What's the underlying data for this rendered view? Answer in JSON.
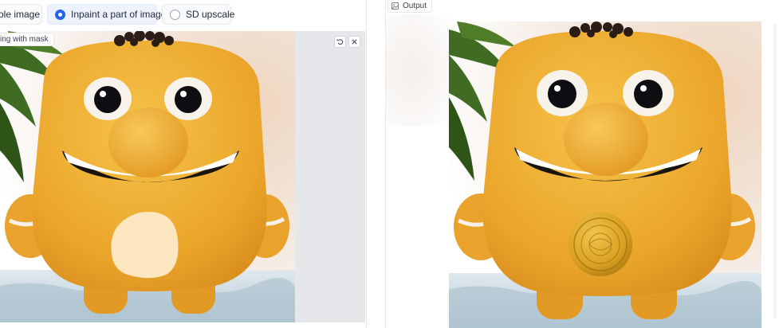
{
  "mode": {
    "options": [
      {
        "label": "ole image",
        "selected": false
      },
      {
        "label": "Inpaint a part of image",
        "selected": true
      },
      {
        "label": "SD upscale",
        "selected": false
      }
    ]
  },
  "editor": {
    "label": "ing with mask",
    "undo_icon": "undo-icon",
    "close_icon": "close-icon"
  },
  "output": {
    "label": "Output",
    "icon": "image-icon"
  },
  "colors": {
    "accent": "#2563eb",
    "character": "#f0b030",
    "mask": "#fde7c1",
    "coin": "#d9a021"
  }
}
